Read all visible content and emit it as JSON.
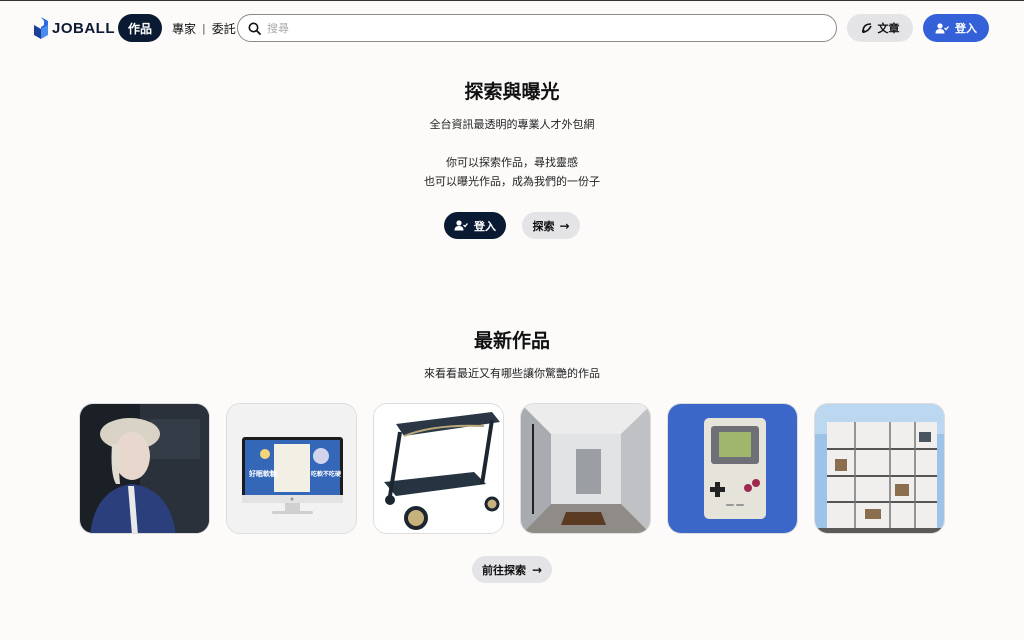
{
  "header": {
    "logo": {
      "text": "JOBALL"
    },
    "nav_active": "作品",
    "nav_links": [
      "專家",
      "委託"
    ],
    "search": {
      "placeholder": "搜尋",
      "value": ""
    },
    "article_button": "文章",
    "login_button": "登入",
    "colors": {
      "login_bg": "#3461d8",
      "active_nav_bg": "#0b1a33"
    }
  },
  "hero": {
    "title": "探索與曝光",
    "subtitle": "全台資訊最透明的專業人才外包網",
    "line1": "你可以探索作品，尋找靈感",
    "line2": "也可以曝光作品，成為我們的一份子",
    "login_button": "登入",
    "explore_button": "探索"
  },
  "latest": {
    "title": "最新作品",
    "subtitle": "來看看最近又有哪些讓你驚艷的作品",
    "works": [
      {
        "name": "work-portrait-photo"
      },
      {
        "name": "work-imac-ad",
        "text_left": "好眠軟糖",
        "text_right": "吃軟不吃硬"
      },
      {
        "name": "work-cart-design"
      },
      {
        "name": "work-interior-render"
      },
      {
        "name": "work-gameboy"
      },
      {
        "name": "work-building-section"
      }
    ],
    "go_explore_button": "前往探索"
  }
}
